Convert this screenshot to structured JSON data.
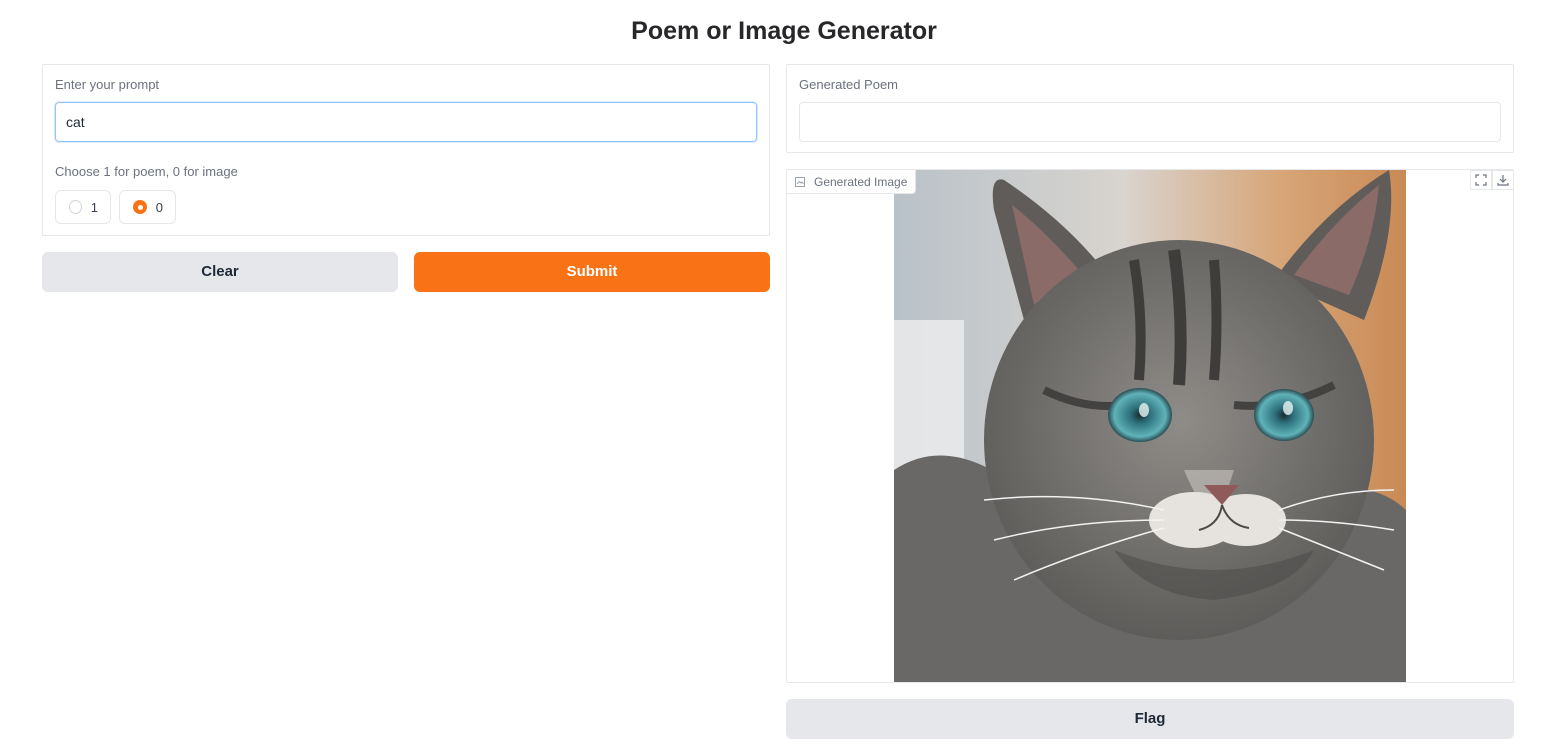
{
  "page": {
    "title": "Poem or Image Generator"
  },
  "input_panel": {
    "prompt_label": "Enter your prompt",
    "prompt_value": "cat",
    "radio_label": "Choose 1 for poem, 0 for image",
    "radio_options": [
      {
        "label": "1",
        "selected": false
      },
      {
        "label": "0",
        "selected": true
      }
    ]
  },
  "actions": {
    "clear_label": "Clear",
    "submit_label": "Submit"
  },
  "output_panel": {
    "poem_label": "Generated Poem",
    "poem_value": "",
    "image_label": "Generated Image",
    "image_subject": "cat"
  },
  "flag": {
    "label": "Flag"
  },
  "colors": {
    "accent": "#f97316",
    "secondary": "#e5e7eb",
    "focus_border": "#93c5fd"
  },
  "icons": [
    "image-icon",
    "fullscreen-icon",
    "download-icon"
  ]
}
